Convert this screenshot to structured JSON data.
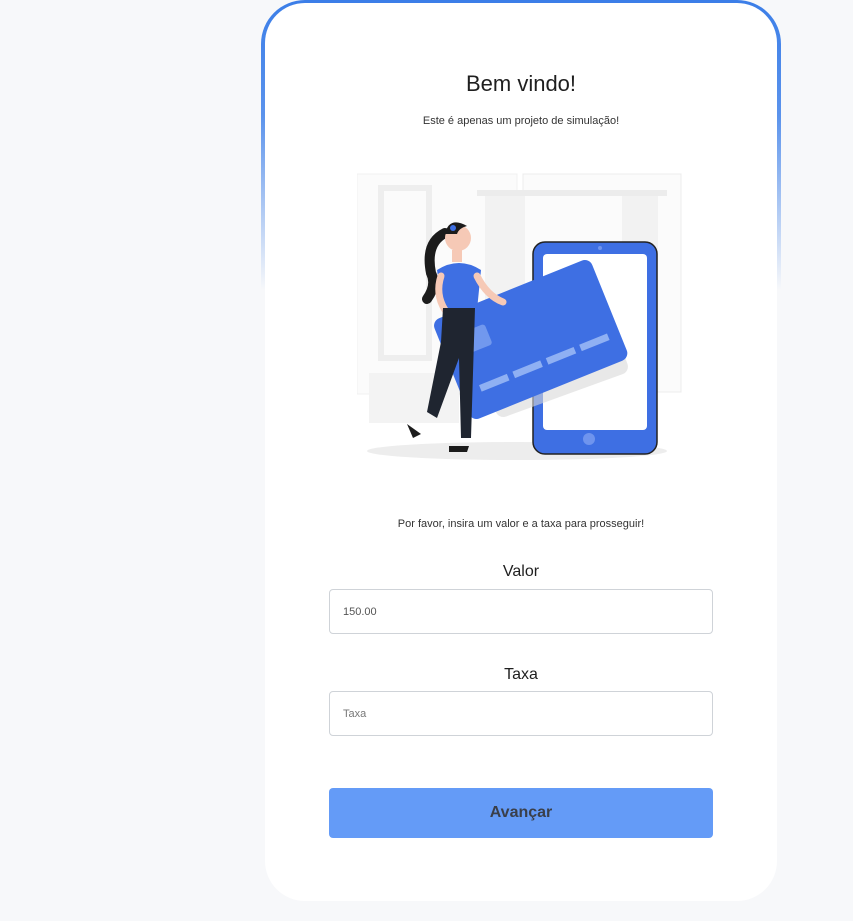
{
  "header": {
    "title": "Bem vindo!",
    "subtitle": "Este é apenas um projeto de simulação!"
  },
  "illustration": {
    "icon": "woman-holding-credit-card-phone-illustration"
  },
  "form": {
    "prompt": "Por favor, insira um valor e a taxa para prosseguir!",
    "valor_label": "Valor",
    "valor_value": "150.00",
    "taxa_label": "Taxa",
    "taxa_placeholder": "Taxa",
    "submit_label": "Avançar"
  },
  "colors": {
    "accent": "#3b7ee8",
    "button": "#649bf7",
    "card_blue": "#3e6fe3"
  }
}
